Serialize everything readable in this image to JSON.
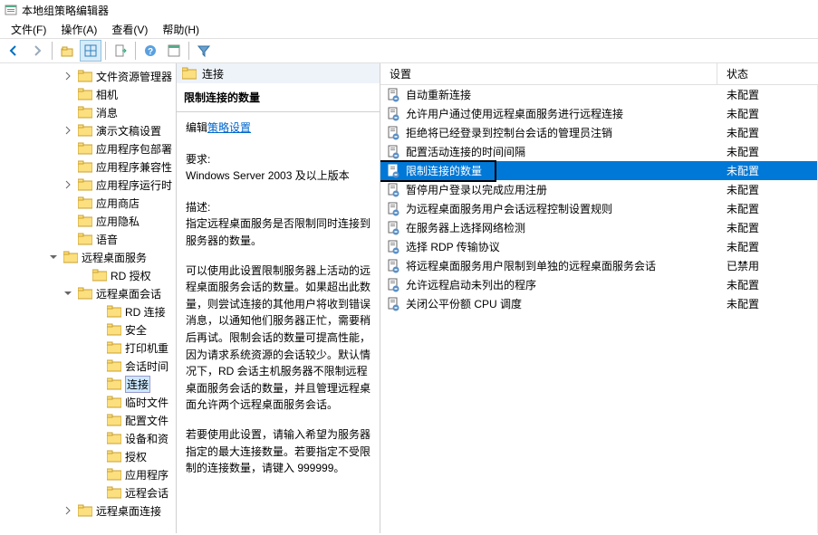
{
  "window": {
    "title": "本地组策略编辑器"
  },
  "menu": {
    "file": "文件(F)",
    "action": "操作(A)",
    "view": "查看(V)",
    "help": "帮助(H)"
  },
  "tree": {
    "items": [
      {
        "indent": 70,
        "toggle": ">",
        "label": "文件资源管理器"
      },
      {
        "indent": 70,
        "toggle": "",
        "label": "相机"
      },
      {
        "indent": 70,
        "toggle": "",
        "label": "消息"
      },
      {
        "indent": 70,
        "toggle": ">",
        "label": "演示文稿设置"
      },
      {
        "indent": 70,
        "toggle": "",
        "label": "应用程序包部署"
      },
      {
        "indent": 70,
        "toggle": "",
        "label": "应用程序兼容性"
      },
      {
        "indent": 70,
        "toggle": ">",
        "label": "应用程序运行时"
      },
      {
        "indent": 70,
        "toggle": "",
        "label": "应用商店"
      },
      {
        "indent": 70,
        "toggle": "",
        "label": "应用隐私"
      },
      {
        "indent": 70,
        "toggle": "",
        "label": "语音"
      },
      {
        "indent": 54,
        "toggle": "v",
        "label": "远程桌面服务"
      },
      {
        "indent": 86,
        "toggle": "",
        "label": "RD 授权"
      },
      {
        "indent": 70,
        "toggle": "v",
        "label": "远程桌面会话"
      },
      {
        "indent": 102,
        "toggle": "",
        "label": "RD 连接"
      },
      {
        "indent": 102,
        "toggle": "",
        "label": "安全"
      },
      {
        "indent": 102,
        "toggle": "",
        "label": "打印机重"
      },
      {
        "indent": 102,
        "toggle": "",
        "label": "会话时间"
      },
      {
        "indent": 102,
        "toggle": "",
        "label": "连接",
        "selected": true
      },
      {
        "indent": 102,
        "toggle": "",
        "label": "临时文件"
      },
      {
        "indent": 102,
        "toggle": "",
        "label": "配置文件"
      },
      {
        "indent": 102,
        "toggle": "",
        "label": "设备和资"
      },
      {
        "indent": 102,
        "toggle": "",
        "label": "授权"
      },
      {
        "indent": 102,
        "toggle": "",
        "label": "应用程序"
      },
      {
        "indent": 102,
        "toggle": "",
        "label": "远程会话"
      },
      {
        "indent": 70,
        "toggle": ">",
        "label": "远程桌面连接"
      }
    ]
  },
  "mid": {
    "header": "连接",
    "title": "限制连接的数量",
    "edit_prefix": "编辑",
    "edit_link": "策略设置",
    "req_label": "要求:",
    "req_text": "Windows Server 2003 及以上版本",
    "desc_label": "描述:",
    "desc1": "指定远程桌面服务是否限制同时连接到服务器的数量。",
    "desc2": "可以使用此设置限制服务器上活动的远程桌面服务会话的数量。如果超出此数量，则尝试连接的其他用户将收到错误消息，以通知他们服务器正忙，需要稍后再试。限制会话的数量可提高性能，因为请求系统资源的会话较少。默认情况下，RD 会话主机服务器不限制远程桌面服务会话的数量，并且管理远程桌面允许两个远程桌面服务会话。",
    "desc3": "若要使用此设置，请输入希望为服务器指定的最大连接数量。若要指定不受限制的连接数量，请键入 999999。"
  },
  "list": {
    "col_setting": "设置",
    "col_state": "状态",
    "rows": [
      {
        "name": "自动重新连接",
        "state": "未配置"
      },
      {
        "name": "允许用户通过使用远程桌面服务进行远程连接",
        "state": "未配置"
      },
      {
        "name": "拒绝将已经登录到控制台会话的管理员注销",
        "state": "未配置"
      },
      {
        "name": "配置活动连接的时间间隔",
        "state": "未配置"
      },
      {
        "name": "限制连接的数量",
        "state": "未配置",
        "selected": true,
        "boxed": true
      },
      {
        "name": "暂停用户登录以完成应用注册",
        "state": "未配置"
      },
      {
        "name": "为远程桌面服务用户会话远程控制设置规则",
        "state": "未配置"
      },
      {
        "name": "在服务器上选择网络检测",
        "state": "未配置"
      },
      {
        "name": "选择 RDP 传输协议",
        "state": "未配置"
      },
      {
        "name": "将远程桌面服务用户限制到单独的远程桌面服务会话",
        "state": "已禁用"
      },
      {
        "name": "允许远程启动未列出的程序",
        "state": "未配置"
      },
      {
        "name": "关闭公平份额 CPU 调度",
        "state": "未配置"
      }
    ]
  }
}
